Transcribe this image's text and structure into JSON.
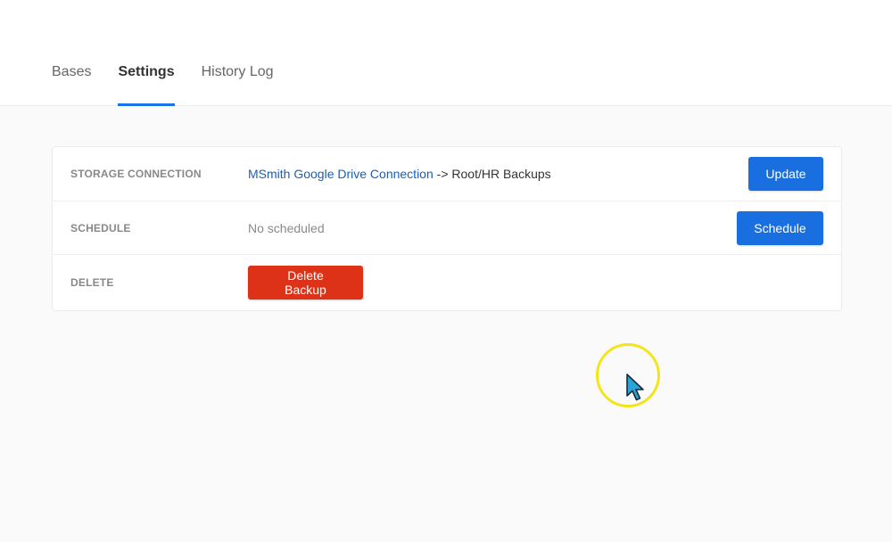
{
  "tabs": [
    {
      "label": "Bases",
      "active": false
    },
    {
      "label": "Settings",
      "active": true
    },
    {
      "label": "History Log",
      "active": false
    }
  ],
  "settings": {
    "storage": {
      "label": "STORAGE CONNECTION",
      "connection_name": "MSmith Google Drive Connection",
      "path": " -> Root/HR Backups",
      "button_label": "Update"
    },
    "schedule": {
      "label": "SCHEDULE",
      "value": "No scheduled",
      "button_label": "Schedule"
    },
    "delete": {
      "label": "DELETE",
      "button_label": "Delete Backup"
    }
  },
  "colors": {
    "accent": "#1a73e8",
    "primary_button": "#1a6fe0",
    "danger_button": "#dd3217",
    "link": "#1a5fb4",
    "cursor_highlight": "#f4e51a",
    "cursor_arrow": "#2aa3d8"
  },
  "icons": {
    "cursor": "mouse-pointer-icon"
  }
}
